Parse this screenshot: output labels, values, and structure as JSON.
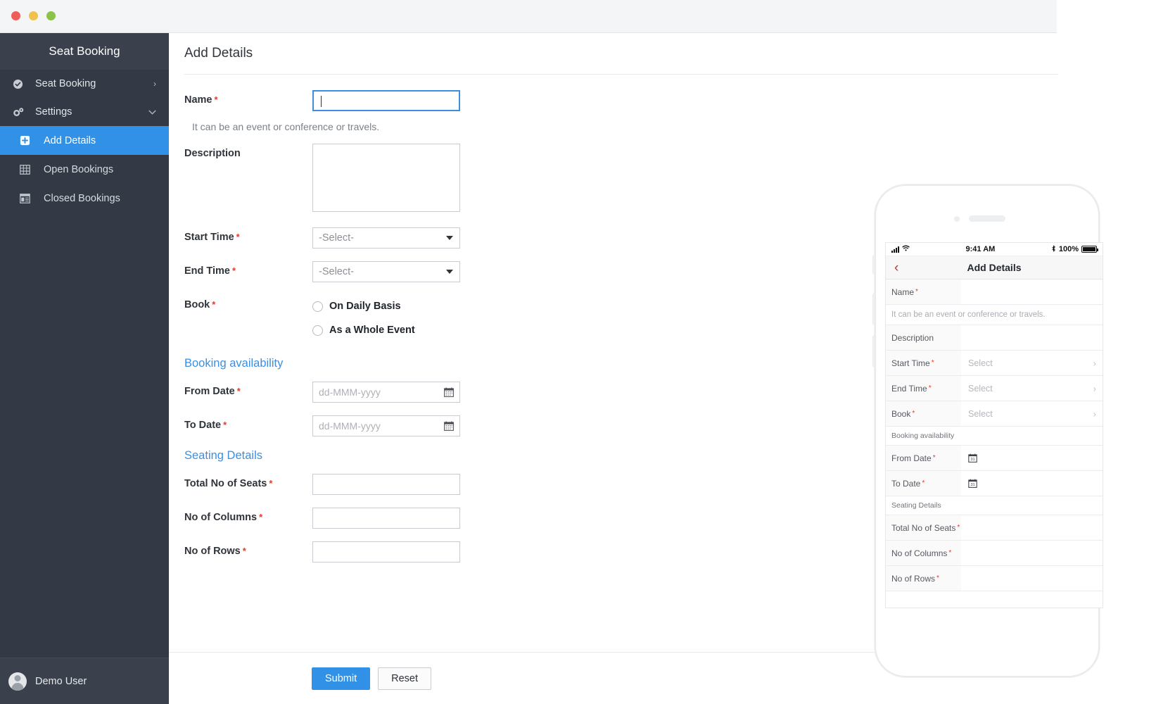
{
  "window": {
    "traffic_lights": [
      {
        "name": "close",
        "color": "#ee5f5b"
      },
      {
        "name": "minimize",
        "color": "#f0c14b"
      },
      {
        "name": "maximize",
        "color": "#8bc34a"
      }
    ]
  },
  "sidebar": {
    "brand": "Seat Booking",
    "items": [
      {
        "label": "Seat Booking",
        "icon": "check-circle-icon",
        "chevron": "›"
      },
      {
        "label": "Settings",
        "icon": "gears-icon",
        "chevron": "⌄"
      }
    ],
    "sub_items": [
      {
        "label": "Add Details",
        "icon": "plus-square-icon",
        "active": true
      },
      {
        "label": "Open Bookings",
        "icon": "grid-icon",
        "active": false
      },
      {
        "label": "Closed Bookings",
        "icon": "list-panel-icon",
        "active": false
      }
    ],
    "user": {
      "name": "Demo User",
      "avatar": "user-avatar-icon"
    }
  },
  "main": {
    "title": "Add Details",
    "fields": {
      "name": {
        "label": "Name",
        "required": true,
        "value": "",
        "focused": true
      },
      "name_hint": "It can be an event or conference or travels.",
      "description": {
        "label": "Description",
        "required": false,
        "value": ""
      },
      "start_time": {
        "label": "Start Time",
        "required": true,
        "value": "-Select-"
      },
      "end_time": {
        "label": "End Time",
        "required": true,
        "value": "-Select-"
      },
      "book": {
        "label": "Book",
        "required": true,
        "options": [
          {
            "label": "On Daily Basis",
            "selected": false
          },
          {
            "label": "As a Whole Event",
            "selected": false
          }
        ]
      },
      "from_date": {
        "label": "From Date",
        "required": true,
        "placeholder": "dd-MMM-yyyy",
        "value": ""
      },
      "to_date": {
        "label": "To Date",
        "required": true,
        "placeholder": "dd-MMM-yyyy",
        "value": ""
      },
      "total_seats": {
        "label": "Total No of Seats",
        "required": true,
        "value": ""
      },
      "columns": {
        "label": "No of Columns",
        "required": true,
        "value": ""
      },
      "rows": {
        "label": "No of Rows",
        "required": true,
        "value": ""
      }
    },
    "sections": {
      "booking_availability": "Booking availability",
      "seating_details": "Seating Details"
    },
    "buttons": {
      "submit": "Submit",
      "reset": "Reset"
    },
    "accent_color": "#3091e6"
  },
  "phone": {
    "status": {
      "time": "9:41 AM",
      "battery_text": "100%",
      "signal": "signal-bars-icon",
      "wifi": "wifi-icon",
      "bluetooth": "✶"
    },
    "nav": {
      "back": "‹",
      "title": "Add Details"
    },
    "rows": [
      {
        "type": "field",
        "label": "Name",
        "required": true,
        "value": "",
        "chevron": ""
      },
      {
        "type": "hint",
        "label": "It can be an event or conference or travels."
      },
      {
        "type": "field",
        "label": "Description",
        "required": false,
        "value": "",
        "chevron": ""
      },
      {
        "type": "field",
        "label": "Start Time",
        "required": true,
        "value": "Select",
        "chevron": "›"
      },
      {
        "type": "field",
        "label": "End Time",
        "required": true,
        "value": "Select",
        "chevron": "›"
      },
      {
        "type": "field",
        "label": "Book",
        "required": true,
        "value": "Select",
        "chevron": "›"
      },
      {
        "type": "section",
        "label": "Booking availability"
      },
      {
        "type": "date",
        "label": "From Date",
        "required": true,
        "value": "",
        "chevron": ""
      },
      {
        "type": "date",
        "label": "To Date",
        "required": true,
        "value": "",
        "chevron": ""
      },
      {
        "type": "section",
        "label": "Seating Details"
      },
      {
        "type": "field",
        "label": "Total No of Seats",
        "required": true,
        "value": "",
        "chevron": ""
      },
      {
        "type": "field",
        "label": "No of Columns",
        "required": true,
        "value": "",
        "chevron": ""
      },
      {
        "type": "field",
        "label": "No of Rows",
        "required": true,
        "value": "",
        "chevron": ""
      }
    ]
  }
}
